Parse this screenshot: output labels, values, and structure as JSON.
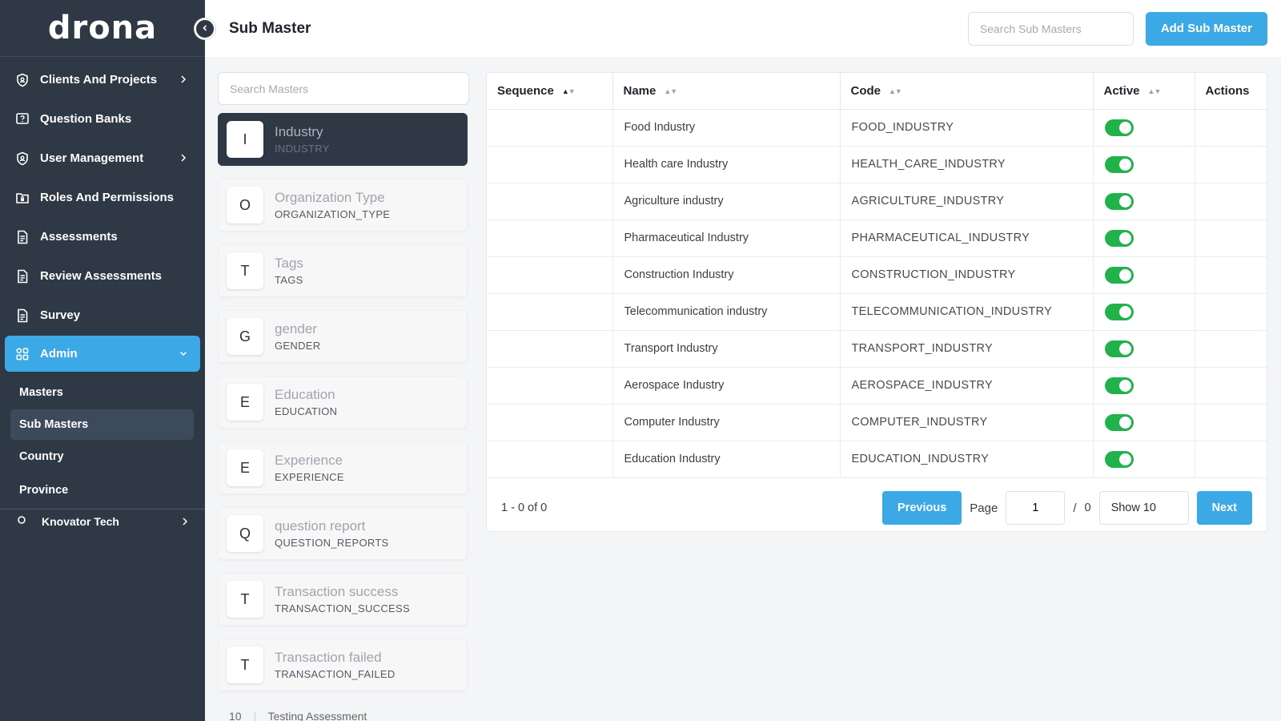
{
  "app": {
    "logo": "drona"
  },
  "header": {
    "title": "Sub Master",
    "search_placeholder": "Search Sub Masters",
    "add_button": "Add Sub Master"
  },
  "sidebar": {
    "items": [
      {
        "label": "Clients And Projects",
        "icon": "shield-icon",
        "chevron": true
      },
      {
        "label": "Question Banks",
        "icon": "question-box-icon",
        "chevron": false
      },
      {
        "label": "User Management",
        "icon": "shield-icon",
        "chevron": true
      },
      {
        "label": "Roles And Permissions",
        "icon": "lock-folder-icon",
        "chevron": false
      },
      {
        "label": "Assessments",
        "icon": "document-icon",
        "chevron": false
      },
      {
        "label": "Review Assessments",
        "icon": "document-icon",
        "chevron": false
      },
      {
        "label": "Survey",
        "icon": "document-icon",
        "chevron": false
      },
      {
        "label": "Admin",
        "icon": "grid-icon",
        "chevron": true,
        "active": true
      }
    ],
    "sub_items": [
      {
        "label": "Masters"
      },
      {
        "label": "Sub Masters",
        "active": true
      },
      {
        "label": "Country"
      },
      {
        "label": "Province"
      }
    ],
    "tenant": "Knovator Tech"
  },
  "masters": {
    "search_placeholder": "Search Masters",
    "items": [
      {
        "letter": "I",
        "name": "Industry",
        "code": "INDUSTRY",
        "active": true
      },
      {
        "letter": "O",
        "name": "Organization Type",
        "code": "ORGANIZATION_TYPE"
      },
      {
        "letter": "T",
        "name": "Tags",
        "code": "TAGS"
      },
      {
        "letter": "G",
        "name": "gender",
        "code": "GENDER"
      },
      {
        "letter": "E",
        "name": "Education",
        "code": "EDUCATION"
      },
      {
        "letter": "E",
        "name": "Experience",
        "code": "EXPERIENCE"
      },
      {
        "letter": "Q",
        "name": "question report",
        "code": "QUESTION_REPORTS"
      },
      {
        "letter": "T",
        "name": "Transaction success",
        "code": "TRANSACTION_SUCCESS"
      },
      {
        "letter": "T",
        "name": "Transaction failed",
        "code": "TRANSACTION_FAILED"
      }
    ],
    "peek": {
      "num": "10",
      "name": "Testing Assessment"
    }
  },
  "table": {
    "columns": [
      "Sequence",
      "Name",
      "Code",
      "Active",
      "Actions"
    ],
    "rows": [
      {
        "sequence": "",
        "name": "Food Industry",
        "code": "FOOD_INDUSTRY",
        "active": true
      },
      {
        "sequence": "",
        "name": "Health care Industry",
        "code": "HEALTH_CARE_INDUSTRY",
        "active": true
      },
      {
        "sequence": "",
        "name": "Agriculture industry",
        "code": "AGRICULTURE_INDUSTRY",
        "active": true
      },
      {
        "sequence": "",
        "name": "Pharmaceutical Industry",
        "code": "PHARMACEUTICAL_INDUSTRY",
        "active": true
      },
      {
        "sequence": "",
        "name": "Construction Industry",
        "code": "CONSTRUCTION_INDUSTRY",
        "active": true
      },
      {
        "sequence": "",
        "name": "Telecommunication industry",
        "code": "TELECOMMUNICATION_INDUSTRY",
        "active": true
      },
      {
        "sequence": "",
        "name": "Transport Industry",
        "code": "TRANSPORT_INDUSTRY",
        "active": true
      },
      {
        "sequence": "",
        "name": "Aerospace Industry",
        "code": "AEROSPACE_INDUSTRY",
        "active": true
      },
      {
        "sequence": "",
        "name": "Computer Industry",
        "code": "COMPUTER_INDUSTRY",
        "active": true
      },
      {
        "sequence": "",
        "name": "Education Industry",
        "code": "EDUCATION_INDUSTRY",
        "active": true
      }
    ]
  },
  "pagination": {
    "range": "1 - 0 of 0",
    "previous": "Previous",
    "page_label": "Page",
    "page_value": "1",
    "slash": "/",
    "total_pages": "0",
    "show": "Show 10",
    "next": "Next"
  },
  "colors": {
    "sidebar": "#2f3845",
    "accent": "#3aa9e6",
    "toggle_on": "#22b24c"
  }
}
